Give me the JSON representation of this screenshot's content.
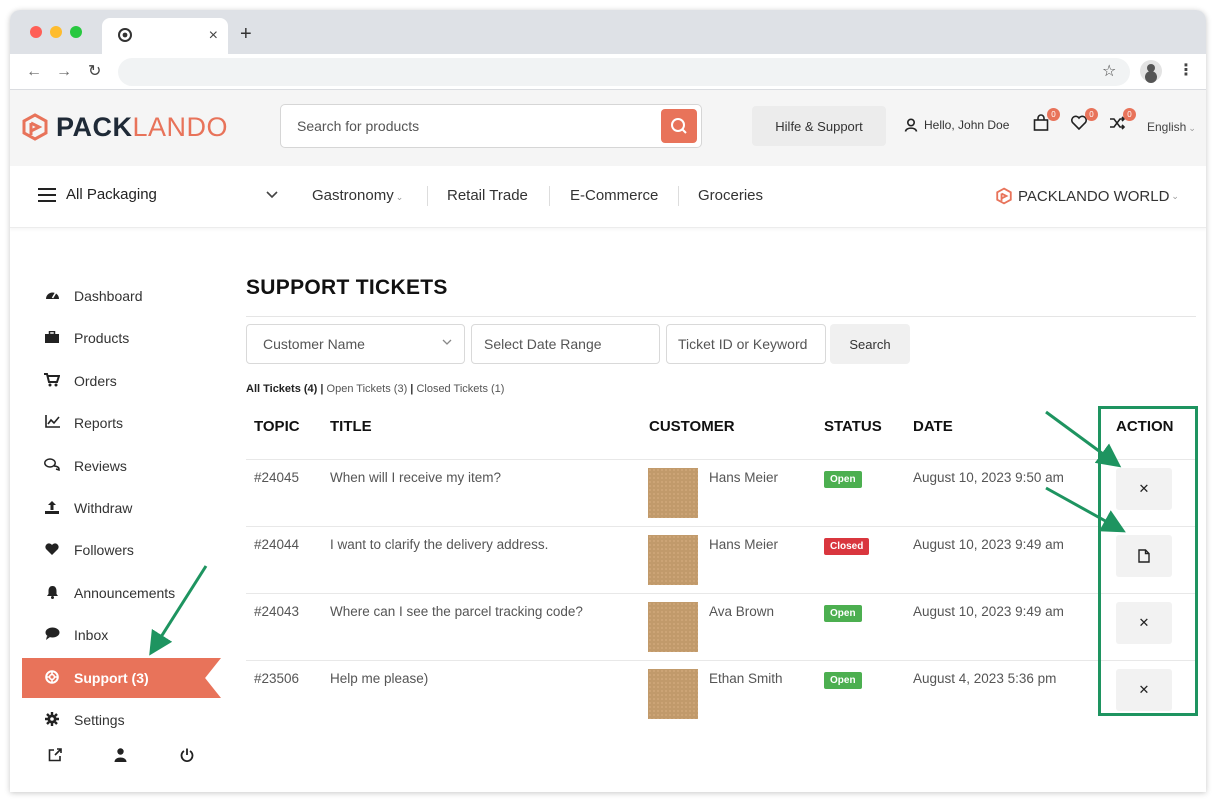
{
  "browser": {
    "tab_close": "×",
    "new_tab": "+",
    "traffic_colors": [
      "#ff5f57",
      "#febc2e",
      "#28c840"
    ]
  },
  "header": {
    "logo_pack": "PACK",
    "logo_lando": "LANDO",
    "search_placeholder": "Search for products",
    "help_label": "Hilfe & Support",
    "hello": "Hello, John Doe",
    "cart_count": "0",
    "wishlist_count": "0",
    "compare_count": "0",
    "language": "English",
    "accent": "#e8735a"
  },
  "catnav": {
    "all_label": "All Packaging",
    "items": [
      "Gastronomy",
      "Retail Trade",
      "E-Commerce",
      "Groceries"
    ],
    "world_label": "PACKLANDO WORLD"
  },
  "sidebar": {
    "items": [
      {
        "label": "Dashboard",
        "icon": "dashboard-icon"
      },
      {
        "label": "Products",
        "icon": "briefcase-icon"
      },
      {
        "label": "Orders",
        "icon": "cart-icon"
      },
      {
        "label": "Reports",
        "icon": "chart-icon"
      },
      {
        "label": "Reviews",
        "icon": "comments-icon"
      },
      {
        "label": "Withdraw",
        "icon": "upload-icon"
      },
      {
        "label": "Followers",
        "icon": "heart-icon"
      },
      {
        "label": "Announcements",
        "icon": "bell-icon"
      },
      {
        "label": "Inbox",
        "icon": "chat-icon"
      },
      {
        "label": "Support (3)",
        "icon": "lifebuoy-icon",
        "active": true
      },
      {
        "label": "Settings",
        "icon": "gear-icon"
      }
    ],
    "footer_icons": [
      "external-link-icon",
      "user-icon",
      "power-icon"
    ]
  },
  "main": {
    "title": "SUPPORT TICKETS",
    "filters": {
      "customer": "Customer Name",
      "date": "Select Date Range",
      "keyword": "Ticket ID or Keyword",
      "search": "Search"
    },
    "ticket_filters": {
      "all": "All Tickets (4)",
      "open": "Open Tickets (3)",
      "closed": "Closed Tickets (1)",
      "sep": "|"
    },
    "columns": {
      "topic": "TOPIC",
      "title": "TITLE",
      "customer": "CUSTOMER",
      "status": "STATUS",
      "date": "DATE",
      "action": "ACTION"
    },
    "rows": [
      {
        "topic": "#24045",
        "title": "When will I receive my item?",
        "customer": "Hans Meier",
        "status": "Open",
        "date": "August 10, 2023 9:50 am",
        "action_icon": "close-icon",
        "action_glyph": "✕"
      },
      {
        "topic": "#24044",
        "title": "I want to clarify the delivery address.",
        "customer": "Hans Meier",
        "status": "Closed",
        "date": "August 10, 2023 9:49 am",
        "action_icon": "document-icon",
        "action_glyph": ""
      },
      {
        "topic": "#24043",
        "title": "Where can I see the parcel tracking code?",
        "customer": "Ava Brown",
        "status": "Open",
        "date": "August 10, 2023 9:49 am",
        "action_icon": "close-icon",
        "action_glyph": "✕"
      },
      {
        "topic": "#23506",
        "title": "Help me please)",
        "customer": "Ethan Smith",
        "status": "Open",
        "date": "August 4, 2023 5:36 pm",
        "action_icon": "close-icon",
        "action_glyph": "✕"
      }
    ],
    "status_colors": {
      "Open": "#4caf50",
      "Closed": "#d9363e"
    }
  },
  "annotation_color": "#1e9460"
}
